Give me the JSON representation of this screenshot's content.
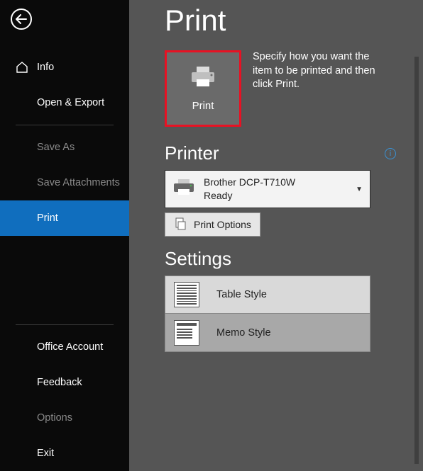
{
  "sidebar": {
    "items": {
      "info": "Info",
      "open_export": "Open & Export",
      "save_as": "Save As",
      "save_attachments": "Save Attachments",
      "print": "Print",
      "office_account": "Office Account",
      "feedback": "Feedback",
      "options": "Options",
      "exit": "Exit"
    }
  },
  "page": {
    "title": "Print",
    "print_button": "Print",
    "hint": "Specify how you want the item to be printed and then click Print."
  },
  "printer": {
    "heading": "Printer",
    "name": "Brother DCP-T710W",
    "status": "Ready",
    "options_btn": "Print Options"
  },
  "settings": {
    "heading": "Settings",
    "table_style": "Table Style",
    "memo_style": "Memo Style"
  }
}
